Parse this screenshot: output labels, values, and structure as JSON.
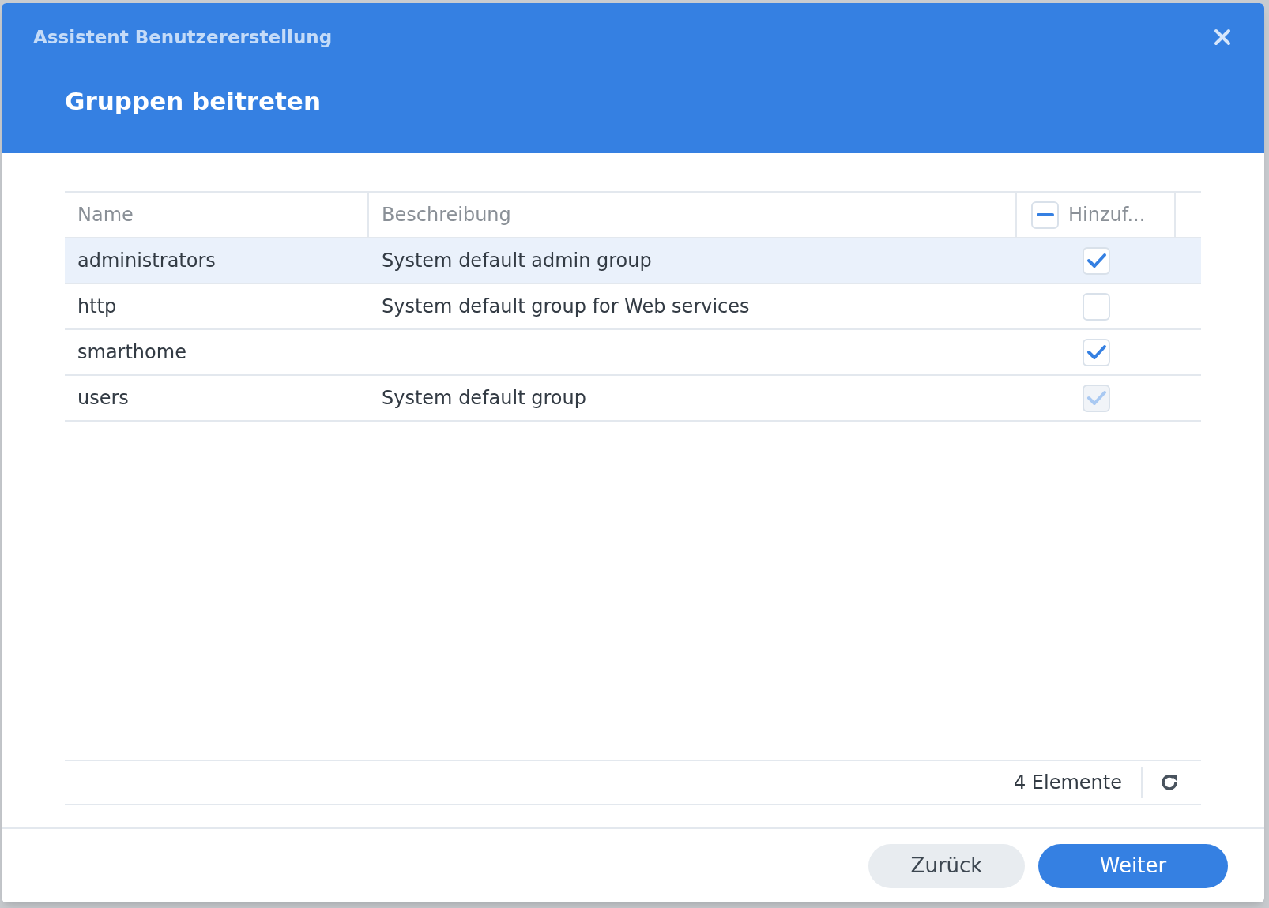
{
  "window": {
    "title": "Assistent Benutzererstellung"
  },
  "heading": "Gruppen beitreten",
  "table": {
    "columns": [
      {
        "label": "Name"
      },
      {
        "label": "Beschreibung"
      },
      {
        "label": "Hinzuf...",
        "kind": "checkbox",
        "indeterminate": true
      }
    ],
    "rows": [
      {
        "name": "administrators",
        "description": "System default admin group",
        "checked": true,
        "disabled": false,
        "selected": true
      },
      {
        "name": "http",
        "description": "System default group for Web services",
        "checked": false,
        "disabled": false,
        "selected": false
      },
      {
        "name": "smarthome",
        "checked": true,
        "disabled": false,
        "selected": false
      },
      {
        "name": "users",
        "description": "System default group",
        "checked": true,
        "disabled": true,
        "selected": false
      }
    ]
  },
  "status_bar": {
    "count": "4 Elemente"
  },
  "buttons": [
    {
      "label": "Zurück",
      "kind": "secondary"
    },
    {
      "label": "Weiter",
      "kind": "primary"
    }
  ]
}
